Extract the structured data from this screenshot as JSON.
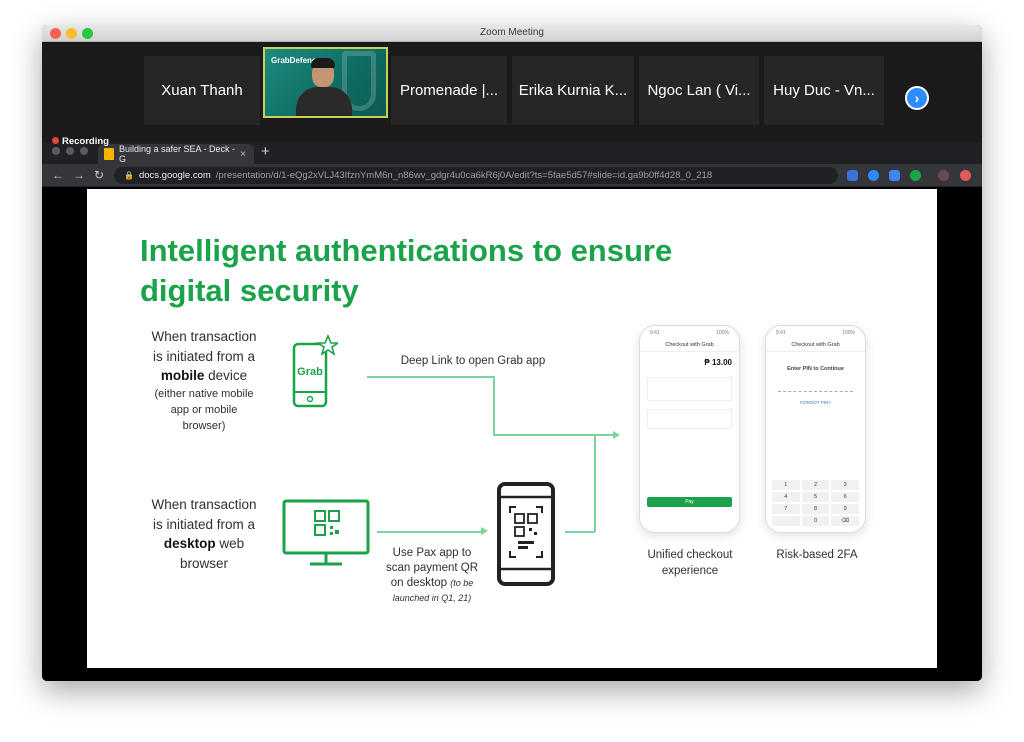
{
  "window": {
    "title": "Zoom Meeting"
  },
  "participants": [
    {
      "name": "Xuan Thanh"
    },
    {
      "name": "Promenade |..."
    },
    {
      "name": "Erika Kurnia K..."
    },
    {
      "name": "Ngoc Lan ( Vi..."
    },
    {
      "name": "Huy Duc - Vn..."
    }
  ],
  "active_video": {
    "logo_text": "GrabDefence"
  },
  "next_arrow_glyph": "›",
  "recording": {
    "label": "Recording"
  },
  "browser": {
    "tab_title": "Building a safer SEA - Deck - G",
    "tab_close": "×",
    "new_tab": "+",
    "url_host": "docs.google.com",
    "url_path": "/presentation/d/1-eQg2xVLJ43IfznYmM6n_n86wv_gdgr4u0ca6kR6j0A/edit?ts=5fae5d57#slide=id.ga9b0ff4d28_0_218",
    "nav": {
      "back": "←",
      "forward": "→",
      "reload": "↻"
    }
  },
  "slide": {
    "title_line1": "Intelligent authentications to ensure",
    "title_line2": "digital security",
    "mobile_desc": {
      "line1": "When transaction",
      "line2": "is initiated from a",
      "bold": "mobile",
      "after_bold": " device",
      "paren1": "(either native mobile",
      "paren2": "app or mobile",
      "paren3": "browser)"
    },
    "desktop_desc": {
      "line1": "When transaction",
      "line2": "is initiated from a",
      "bold": "desktop",
      "after_bold": " web",
      "line4": "browser"
    },
    "deep_link_label": "Deep Link to open Grab app",
    "pax_label": {
      "line1": "Use Pax app to",
      "line2": "scan payment QR",
      "line3": "on desktop",
      "note": "(to be",
      "note2": "launched in Q1, 21)"
    },
    "checkout_label": {
      "line1": "Unified checkout",
      "line2": "experience"
    },
    "twofa_label": "Risk-based 2FA",
    "grab_icon_text": "Grab",
    "phone1": {
      "header": "Checkout with Grab",
      "amount": "₱ 13.00",
      "pay": "Pay"
    },
    "phone2": {
      "header": "Checkout with Grab",
      "pin_title": "Enter PIN to Continue",
      "forgot": "FORGOT PIN?"
    },
    "keypad": [
      "1",
      "2",
      "3",
      "4",
      "5",
      "6",
      "7",
      "8",
      "9",
      "",
      "0",
      "⌫"
    ]
  },
  "colors": {
    "brand_green": "#1aa34a",
    "connector_green": "#7cd3a0",
    "zoom_blue": "#2d8cff"
  },
  "icons": [
    "grab-phone-icon",
    "desktop-qr-icon",
    "qr-scan-phone-icon",
    "lock-icon",
    "next-arrow-icon"
  ]
}
